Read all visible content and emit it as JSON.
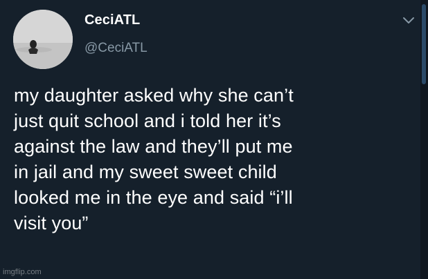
{
  "tweet": {
    "display_name": "CeciATL",
    "handle": "@CeciATL",
    "text_lines": [
      "my daughter asked why she can’t",
      "just quit school and i told her it’s",
      "against the law and they’ll put me",
      "in jail and my sweet sweet child",
      "looked me in the eye and said “i’ll",
      "visit you”"
    ],
    "menu_icon": "chevron-down-icon"
  },
  "watermark": "imgflip.com",
  "colors": {
    "background": "#15202b",
    "text": "#ffffff",
    "handle": "#8899a6"
  }
}
